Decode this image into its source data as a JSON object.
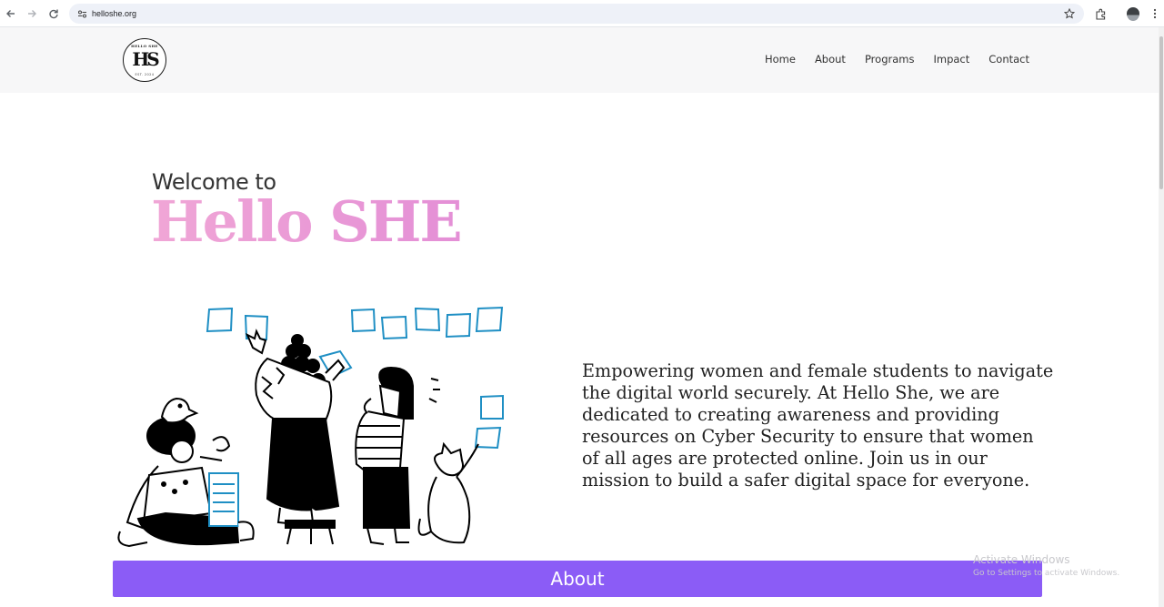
{
  "browser": {
    "url": "helloshe.org",
    "icons": [
      "back-arrow-icon",
      "forward-arrow-icon",
      "reload-icon",
      "site-settings-icon",
      "bookmark-star-icon",
      "extensions-icon",
      "profile-avatar-icon",
      "more-menu-icon"
    ]
  },
  "header": {
    "logo": {
      "top_text": "HELLO SHE",
      "monogram": "HS",
      "bottom_text": "EST. 2024"
    },
    "nav": [
      {
        "label": "Home"
      },
      {
        "label": "About"
      },
      {
        "label": "Programs"
      },
      {
        "label": "Impact"
      },
      {
        "label": "Contact"
      }
    ]
  },
  "hero": {
    "welcome": "Welcome to",
    "title": "Hello SHE",
    "tagline": "Empowering women and female students to navigate the digital world securely. At Hello She, we are dedicated to creating awareness and providing resources on Cyber Security to ensure that women of all ages are protected online. Join us in our mission to build a safer digital space for everyone."
  },
  "about_section": {
    "label": "About"
  },
  "os_watermark": {
    "line1": "Activate Windows",
    "line2": "Go to Settings to activate Windows."
  },
  "colors": {
    "title_gradient_start": "#f0a6d6",
    "title_gradient_end": "#e48fd6",
    "about_bar": "#8b5cf6",
    "note_blue": "#1f8fc4",
    "header_bg": "#f7f7f8"
  }
}
